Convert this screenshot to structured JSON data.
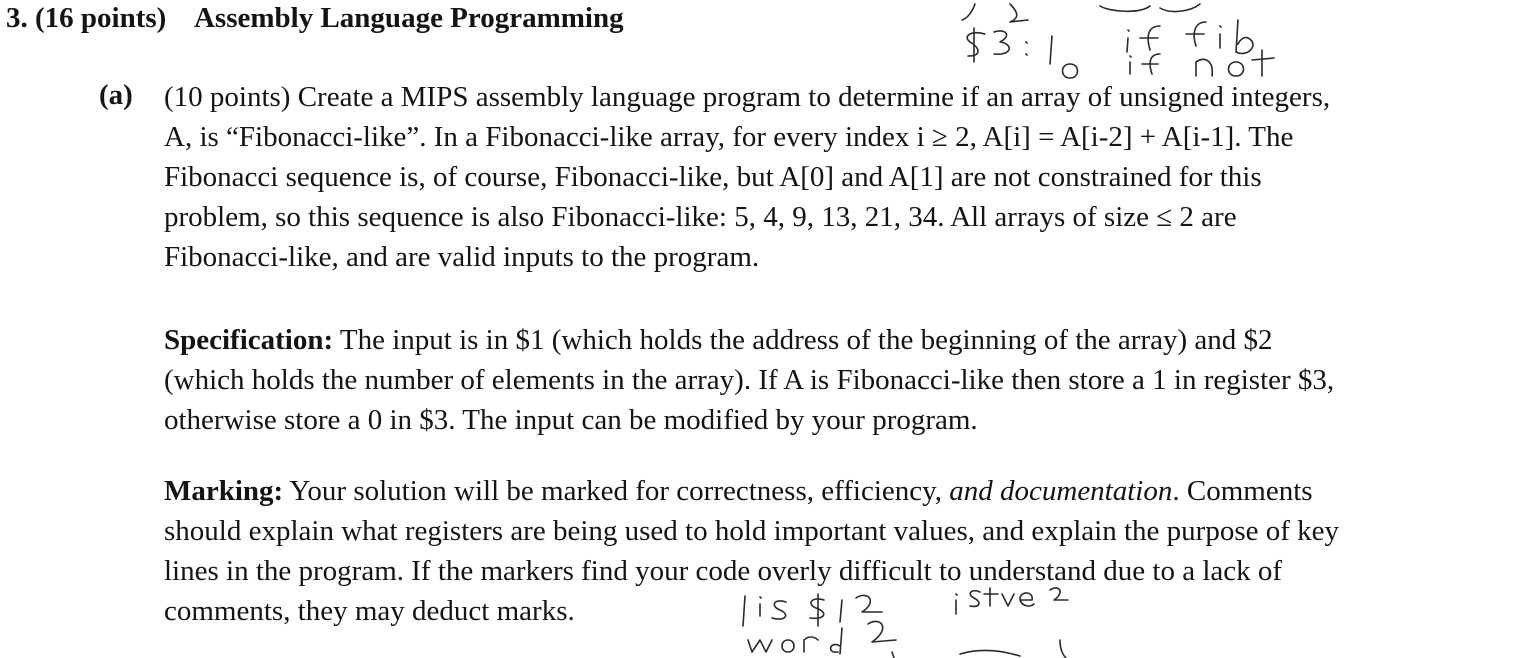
{
  "question": {
    "number": "3.",
    "points": "(16 points)",
    "title": "Assembly Language Programming"
  },
  "part_a": {
    "label": "(a)",
    "lines": [
      "(10 points) Create a MIPS assembly language program to determine if an array of unsigned integers,",
      "A, is “Fibonacci-like”. In a Fibonacci-like array, for every index i ≥ 2, A[i] = A[i-2] + A[i-1]. The",
      "Fibonacci sequence is, of course, Fibonacci-like, but A[0] and A[1] are not constrained for this",
      "problem, so this sequence is also Fibonacci-like: 5, 4, 9, 13, 21, 34. All arrays of size ≤ 2 are",
      "Fibonacci-like, and are valid inputs to the program."
    ]
  },
  "specification": {
    "heading": "Specification:",
    "lines": [
      " The input is in $1 (which holds the address of the beginning of the array) and $2",
      "(which holds the number of elements in the array). If A is Fibonacci-like then store a 1 in register $3,",
      "otherwise store a 0 in $3. The input can be modified by your program."
    ]
  },
  "marking": {
    "heading": "Marking:",
    "first_line_before_em": " Your solution will be marked for correctness, efficiency, ",
    "first_line_em": "and documentation",
    "first_line_after_em": ". Comments",
    "lines": [
      "should explain what registers are being used to hold important values, and explain the purpose of key",
      "lines in the program. If the markers find your code overly difficult to understand due to a lack of",
      "comments, they may deduct marks."
    ]
  }
}
